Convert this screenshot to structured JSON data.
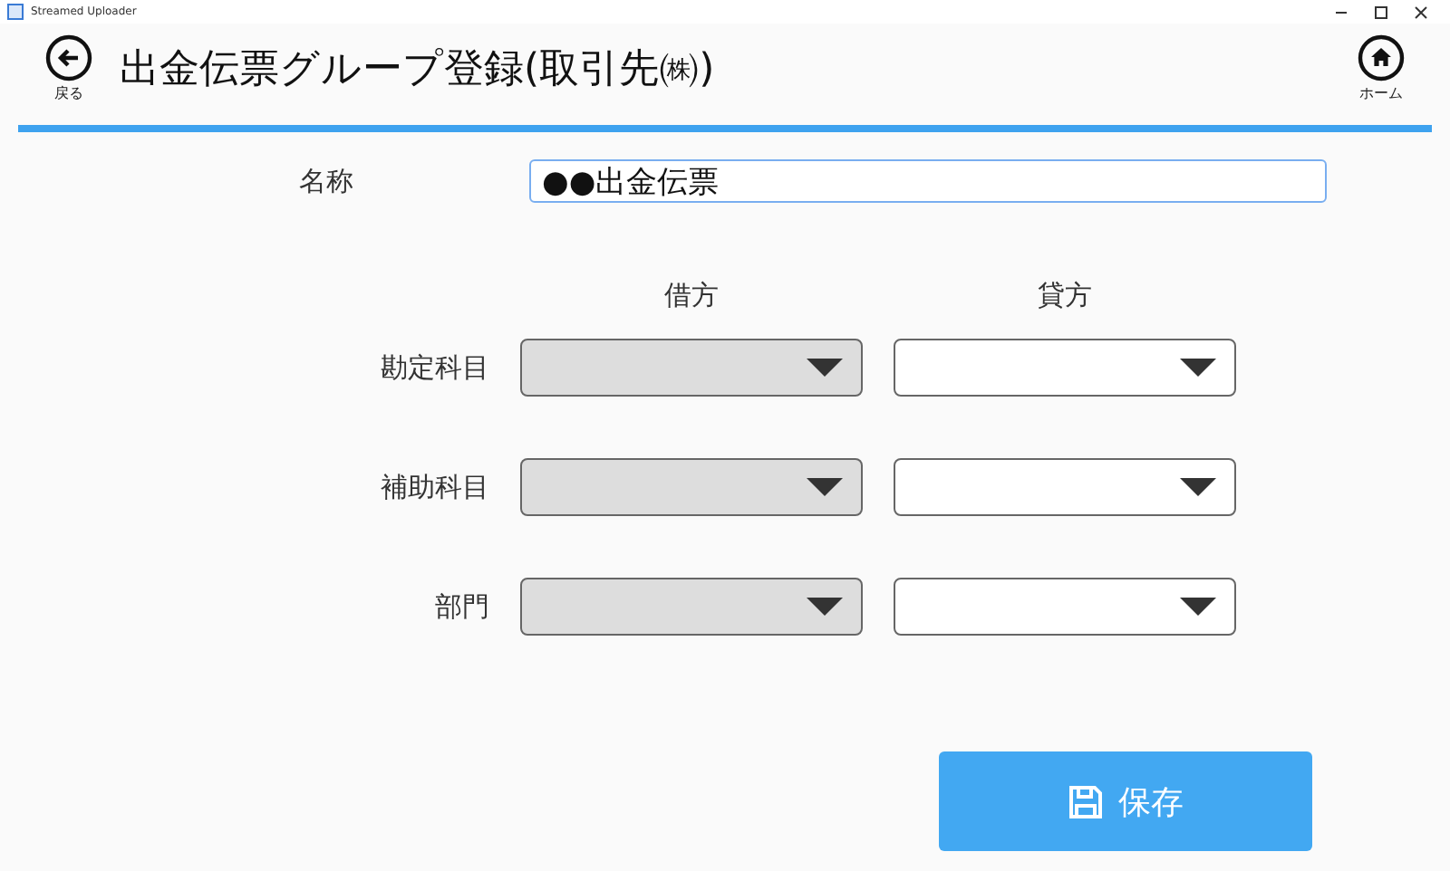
{
  "window": {
    "title": "Streamed Uploader"
  },
  "header": {
    "back_label": "戻る",
    "title": "出金伝票グループ登録(取引先㈱)",
    "home_label": "ホーム"
  },
  "name_field": {
    "label": "名称",
    "value": "●●出金伝票"
  },
  "columns": [
    "借方",
    "貸方"
  ],
  "rows": [
    {
      "label": "勘定科目",
      "debit": {
        "disabled": true
      },
      "credit": {
        "disabled": false
      }
    },
    {
      "label": "補助科目",
      "debit": {
        "disabled": true
      },
      "credit": {
        "disabled": false
      }
    },
    {
      "label": "部門",
      "debit": {
        "disabled": true
      },
      "credit": {
        "disabled": false
      }
    }
  ],
  "save_button": {
    "label": "保存"
  }
}
